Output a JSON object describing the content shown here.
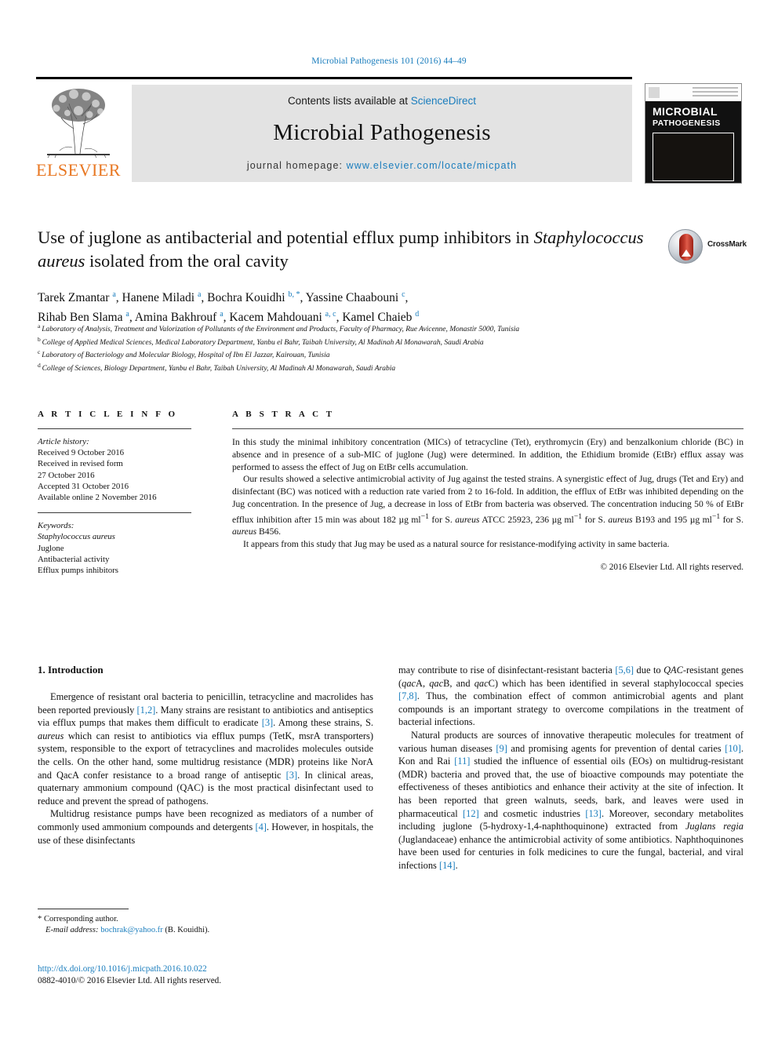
{
  "running_head": "Microbial Pathogenesis 101 (2016) 44–49",
  "masthead": {
    "publisher_name": "ELSEVIER",
    "contents_prefix": "Contents lists available at ",
    "contents_link": "ScienceDirect",
    "journal_name": "Microbial Pathogenesis",
    "homepage_prefix": "journal homepage: ",
    "homepage_url": "www.elsevier.com/locate/micpath",
    "cover": {
      "title_line1": "MICROBIAL",
      "title_line2": "PATHOGENESIS"
    }
  },
  "crossmark": {
    "label": "CrossMark"
  },
  "article": {
    "title_line1": "Use of juglone as antibacterial and potential efflux pump inhibitors in",
    "title_italic": "Staphylococcus aureus",
    "title_line2_rest": " isolated from the oral cavity",
    "authors": [
      {
        "name": "Tarek Zmantar",
        "marks": "a"
      },
      {
        "name": "Hanene Miladi",
        "marks": "a"
      },
      {
        "name": "Bochra Kouidhi",
        "marks": "b, *"
      },
      {
        "name": "Yassine Chaabouni",
        "marks": "c"
      },
      {
        "name": "Rihab Ben Slama",
        "marks": "a"
      },
      {
        "name": "Amina Bakhrouf",
        "marks": "a"
      },
      {
        "name": "Kacem Mahdouani",
        "marks": "a, c"
      },
      {
        "name": "Kamel Chaieb",
        "marks": "d"
      }
    ],
    "affiliations": [
      {
        "mark": "a",
        "text": "Laboratory of Analysis, Treatment and Valorization of Pollutants of the Environment and Products, Faculty of Pharmacy, Rue Avicenne, Monastir 5000, Tunisia"
      },
      {
        "mark": "b",
        "text": "College of Applied Medical Sciences, Medical Laboratory Department, Yanbu el Bahr, Taibah University, Al Madinah Al Monawarah, Saudi Arabia"
      },
      {
        "mark": "c",
        "text": "Laboratory of Bacteriology and Molecular Biology, Hospital of Ibn El Jazzar, Kairouan, Tunisia"
      },
      {
        "mark": "d",
        "text": "College of Sciences, Biology Department, Yanbu el Bahr, Taibah University, Al Madinah Al Monawarah, Saudi Arabia"
      }
    ]
  },
  "article_info": {
    "heading": "A R T I C L E   I N F O",
    "history_label": "Article history:",
    "history": [
      "Received 9 October 2016",
      "Received in revised form",
      "27 October 2016",
      "Accepted 31 October 2016",
      "Available online 2 November 2016"
    ],
    "keywords_label": "Keywords:",
    "keywords": [
      "Staphylococcus aureus",
      "Juglone",
      "Antibacterial activity",
      "Efflux pumps inhibitors"
    ],
    "keyword_italic_index": 0
  },
  "abstract": {
    "heading": "A B S T R A C T",
    "paragraphs": [
      "In this study the minimal inhibitory concentration (MICs) of tetracycline (Tet), erythromycin (Ery) and benzalkonium chloride (BC) in absence and in presence of a sub-MIC of juglone (Jug) were determined. In addition, the Ethidium bromide (EtBr) efflux assay was performed to assess the effect of Jug on EtBr cells accumulation.",
      "It appears from this study that Jug may be used as a natural source for resistance-modifying activity in same bacteria."
    ],
    "results_p_a": "Our results showed a selective antimicrobial activity of Jug against the tested strains. A synergistic effect of Jug, drugs (Tet and Ery) and disinfectant (BC) was noticed with a reduction rate varied from 2 to 16-fold. In addition, the efflux of EtBr was inhibited depending on the Jug concentration. In the presence of Jug, a decrease in loss of EtBr from bacteria was observed. The concentration inducing 50 % of EtBr efflux inhibition after 15 min was about 182 µg ml",
    "results_sup1": "−1",
    "results_p_b": " for S. ",
    "results_italic1": "aureus",
    "results_p_c": " ATCC 25923, 236 µg ml",
    "results_sup2": "−1",
    "results_p_d": " for S. ",
    "results_italic2": "aureus",
    "results_p_e": " B193 and 195 µg ml",
    "results_sup3": "−1",
    "results_p_f": " for S. ",
    "results_italic3": "aureus",
    "results_p_g": " B456.",
    "copyright": "© 2016 Elsevier Ltd. All rights reserved."
  },
  "body": {
    "section_number_title": "1. Introduction",
    "left_paragraphs": [
      {
        "segments": [
          {
            "t": "Emergence of resistant oral bacteria to penicillin, tetracycline and macrolides has been reported previously ",
            "style": "plain"
          },
          {
            "t": "[1,2]",
            "style": "ref"
          },
          {
            "t": ". Many strains are resistant to antibiotics and antiseptics via efflux pumps that makes them difficult to eradicate ",
            "style": "plain"
          },
          {
            "t": "[3]",
            "style": "ref"
          },
          {
            "t": ". Among these strains, S. ",
            "style": "plain"
          },
          {
            "t": "aureus",
            "style": "italic"
          },
          {
            "t": " which can resist to antibiotics via efflux pumps (TetK, msrA transporters) system, responsible to the export of tetracyclines and macrolides molecules outside the cells. On the other hand, some multidrug resistance (MDR) proteins like NorA and QacA confer resistance to a broad range of antiseptic ",
            "style": "plain"
          },
          {
            "t": "[3]",
            "style": "ref"
          },
          {
            "t": ". In clinical areas, quaternary ammonium compound (QAC) is the most practical disinfectant used to reduce and prevent the spread of pathogens.",
            "style": "plain"
          }
        ]
      },
      {
        "segments": [
          {
            "t": "Multidrug resistance pumps have been recognized as mediators of a number of commonly used ammonium compounds and detergents ",
            "style": "plain"
          },
          {
            "t": "[4]",
            "style": "ref"
          },
          {
            "t": ". However, in hospitals, the use of these disinfectants",
            "style": "plain"
          }
        ]
      }
    ],
    "right_paragraphs": [
      {
        "segments": [
          {
            "t": "may contribute to rise of disinfectant-resistant bacteria ",
            "style": "plain"
          },
          {
            "t": "[5,6]",
            "style": "ref"
          },
          {
            "t": " due to ",
            "style": "plain"
          },
          {
            "t": "QAC",
            "style": "italic"
          },
          {
            "t": "-resistant genes (",
            "style": "plain"
          },
          {
            "t": "qac",
            "style": "italic"
          },
          {
            "t": "A, ",
            "style": "plain"
          },
          {
            "t": "qac",
            "style": "italic"
          },
          {
            "t": "B, and ",
            "style": "plain"
          },
          {
            "t": "qac",
            "style": "italic"
          },
          {
            "t": "C) which has been identified in several staphylococcal species ",
            "style": "plain"
          },
          {
            "t": "[7,8]",
            "style": "ref"
          },
          {
            "t": ". Thus, the combination effect of common antimicrobial agents and plant compounds is an important strategy to overcome compilations in the treatment of bacterial infections.",
            "style": "plain"
          }
        ]
      },
      {
        "segments": [
          {
            "t": "Natural products are sources of innovative therapeutic molecules for treatment of various human diseases ",
            "style": "plain"
          },
          {
            "t": "[9]",
            "style": "ref"
          },
          {
            "t": " and promising agents for prevention of dental caries ",
            "style": "plain"
          },
          {
            "t": "[10]",
            "style": "ref"
          },
          {
            "t": ". Kon and Rai ",
            "style": "plain"
          },
          {
            "t": "[11]",
            "style": "ref"
          },
          {
            "t": " studied the influence of essential oils (EOs) on multidrug-resistant (MDR) bacteria and proved that, the use of bioactive compounds may potentiate the effectiveness of theses antibiotics and enhance their activity at the site of infection. It has been reported that green walnuts, seeds, bark, and leaves were used in pharmaceutical ",
            "style": "plain"
          },
          {
            "t": "[12]",
            "style": "ref"
          },
          {
            "t": " and cosmetic industries ",
            "style": "plain"
          },
          {
            "t": "[13]",
            "style": "ref"
          },
          {
            "t": ". Moreover, secondary metabolites including juglone (5-hydroxy-1,4-naphthoquinone) extracted from ",
            "style": "plain"
          },
          {
            "t": "Juglans regia",
            "style": "italic"
          },
          {
            "t": " (Juglandaceae) enhance the antimicrobial activity of some antibiotics. Naphthoquinones have been used for centuries in folk medicines to cure the fungal, bacterial, and viral infections ",
            "style": "plain"
          },
          {
            "t": "[14]",
            "style": "ref"
          },
          {
            "t": ".",
            "style": "plain"
          }
        ]
      }
    ]
  },
  "footnote": {
    "corresponding": "* Corresponding author.",
    "email_label": "E-mail address:",
    "email": "bochrak@yahoo.fr",
    "email_suffix": " (B. Kouidhi)."
  },
  "doi": {
    "url": "http://dx.doi.org/10.1016/j.micpath.2016.10.022",
    "issn_line": "0882-4010/© 2016 Elsevier Ltd. All rights reserved."
  },
  "colors": {
    "link_blue": "#1a7dbd",
    "elsevier_orange": "#e87722",
    "band_gray": "#e3e3e3",
    "crossmark_red": "#c0392b"
  }
}
